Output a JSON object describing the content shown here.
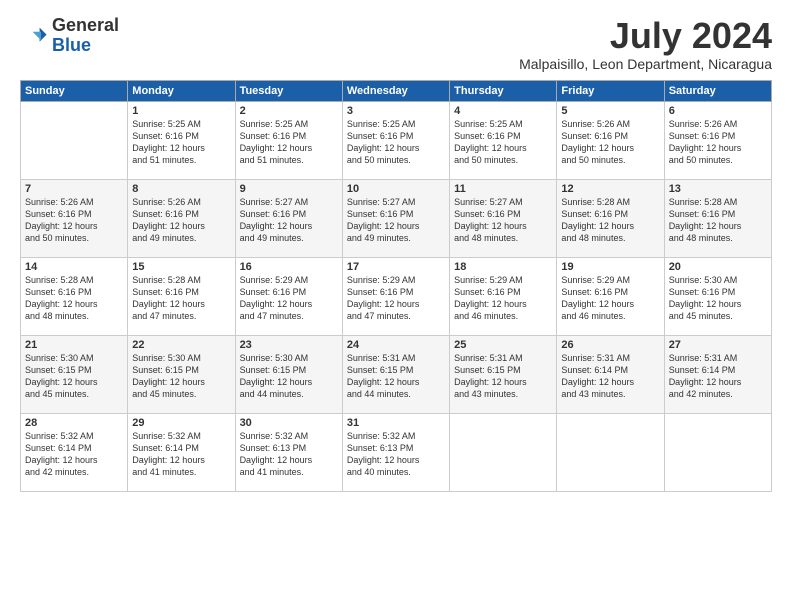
{
  "logo": {
    "general": "General",
    "blue": "Blue"
  },
  "title": "July 2024",
  "location": "Malpaisillo, Leon Department, Nicaragua",
  "headers": [
    "Sunday",
    "Monday",
    "Tuesday",
    "Wednesday",
    "Thursday",
    "Friday",
    "Saturday"
  ],
  "weeks": [
    [
      {
        "day": "",
        "info": ""
      },
      {
        "day": "1",
        "info": "Sunrise: 5:25 AM\nSunset: 6:16 PM\nDaylight: 12 hours\nand 51 minutes."
      },
      {
        "day": "2",
        "info": "Sunrise: 5:25 AM\nSunset: 6:16 PM\nDaylight: 12 hours\nand 51 minutes."
      },
      {
        "day": "3",
        "info": "Sunrise: 5:25 AM\nSunset: 6:16 PM\nDaylight: 12 hours\nand 50 minutes."
      },
      {
        "day": "4",
        "info": "Sunrise: 5:25 AM\nSunset: 6:16 PM\nDaylight: 12 hours\nand 50 minutes."
      },
      {
        "day": "5",
        "info": "Sunrise: 5:26 AM\nSunset: 6:16 PM\nDaylight: 12 hours\nand 50 minutes."
      },
      {
        "day": "6",
        "info": "Sunrise: 5:26 AM\nSunset: 6:16 PM\nDaylight: 12 hours\nand 50 minutes."
      }
    ],
    [
      {
        "day": "7",
        "info": "Sunrise: 5:26 AM\nSunset: 6:16 PM\nDaylight: 12 hours\nand 50 minutes."
      },
      {
        "day": "8",
        "info": "Sunrise: 5:26 AM\nSunset: 6:16 PM\nDaylight: 12 hours\nand 49 minutes."
      },
      {
        "day": "9",
        "info": "Sunrise: 5:27 AM\nSunset: 6:16 PM\nDaylight: 12 hours\nand 49 minutes."
      },
      {
        "day": "10",
        "info": "Sunrise: 5:27 AM\nSunset: 6:16 PM\nDaylight: 12 hours\nand 49 minutes."
      },
      {
        "day": "11",
        "info": "Sunrise: 5:27 AM\nSunset: 6:16 PM\nDaylight: 12 hours\nand 48 minutes."
      },
      {
        "day": "12",
        "info": "Sunrise: 5:28 AM\nSunset: 6:16 PM\nDaylight: 12 hours\nand 48 minutes."
      },
      {
        "day": "13",
        "info": "Sunrise: 5:28 AM\nSunset: 6:16 PM\nDaylight: 12 hours\nand 48 minutes."
      }
    ],
    [
      {
        "day": "14",
        "info": "Sunrise: 5:28 AM\nSunset: 6:16 PM\nDaylight: 12 hours\nand 48 minutes."
      },
      {
        "day": "15",
        "info": "Sunrise: 5:28 AM\nSunset: 6:16 PM\nDaylight: 12 hours\nand 47 minutes."
      },
      {
        "day": "16",
        "info": "Sunrise: 5:29 AM\nSunset: 6:16 PM\nDaylight: 12 hours\nand 47 minutes."
      },
      {
        "day": "17",
        "info": "Sunrise: 5:29 AM\nSunset: 6:16 PM\nDaylight: 12 hours\nand 47 minutes."
      },
      {
        "day": "18",
        "info": "Sunrise: 5:29 AM\nSunset: 6:16 PM\nDaylight: 12 hours\nand 46 minutes."
      },
      {
        "day": "19",
        "info": "Sunrise: 5:29 AM\nSunset: 6:16 PM\nDaylight: 12 hours\nand 46 minutes."
      },
      {
        "day": "20",
        "info": "Sunrise: 5:30 AM\nSunset: 6:16 PM\nDaylight: 12 hours\nand 45 minutes."
      }
    ],
    [
      {
        "day": "21",
        "info": "Sunrise: 5:30 AM\nSunset: 6:15 PM\nDaylight: 12 hours\nand 45 minutes."
      },
      {
        "day": "22",
        "info": "Sunrise: 5:30 AM\nSunset: 6:15 PM\nDaylight: 12 hours\nand 45 minutes."
      },
      {
        "day": "23",
        "info": "Sunrise: 5:30 AM\nSunset: 6:15 PM\nDaylight: 12 hours\nand 44 minutes."
      },
      {
        "day": "24",
        "info": "Sunrise: 5:31 AM\nSunset: 6:15 PM\nDaylight: 12 hours\nand 44 minutes."
      },
      {
        "day": "25",
        "info": "Sunrise: 5:31 AM\nSunset: 6:15 PM\nDaylight: 12 hours\nand 43 minutes."
      },
      {
        "day": "26",
        "info": "Sunrise: 5:31 AM\nSunset: 6:14 PM\nDaylight: 12 hours\nand 43 minutes."
      },
      {
        "day": "27",
        "info": "Sunrise: 5:31 AM\nSunset: 6:14 PM\nDaylight: 12 hours\nand 42 minutes."
      }
    ],
    [
      {
        "day": "28",
        "info": "Sunrise: 5:32 AM\nSunset: 6:14 PM\nDaylight: 12 hours\nand 42 minutes."
      },
      {
        "day": "29",
        "info": "Sunrise: 5:32 AM\nSunset: 6:14 PM\nDaylight: 12 hours\nand 41 minutes."
      },
      {
        "day": "30",
        "info": "Sunrise: 5:32 AM\nSunset: 6:13 PM\nDaylight: 12 hours\nand 41 minutes."
      },
      {
        "day": "31",
        "info": "Sunrise: 5:32 AM\nSunset: 6:13 PM\nDaylight: 12 hours\nand 40 minutes."
      },
      {
        "day": "",
        "info": ""
      },
      {
        "day": "",
        "info": ""
      },
      {
        "day": "",
        "info": ""
      }
    ]
  ]
}
